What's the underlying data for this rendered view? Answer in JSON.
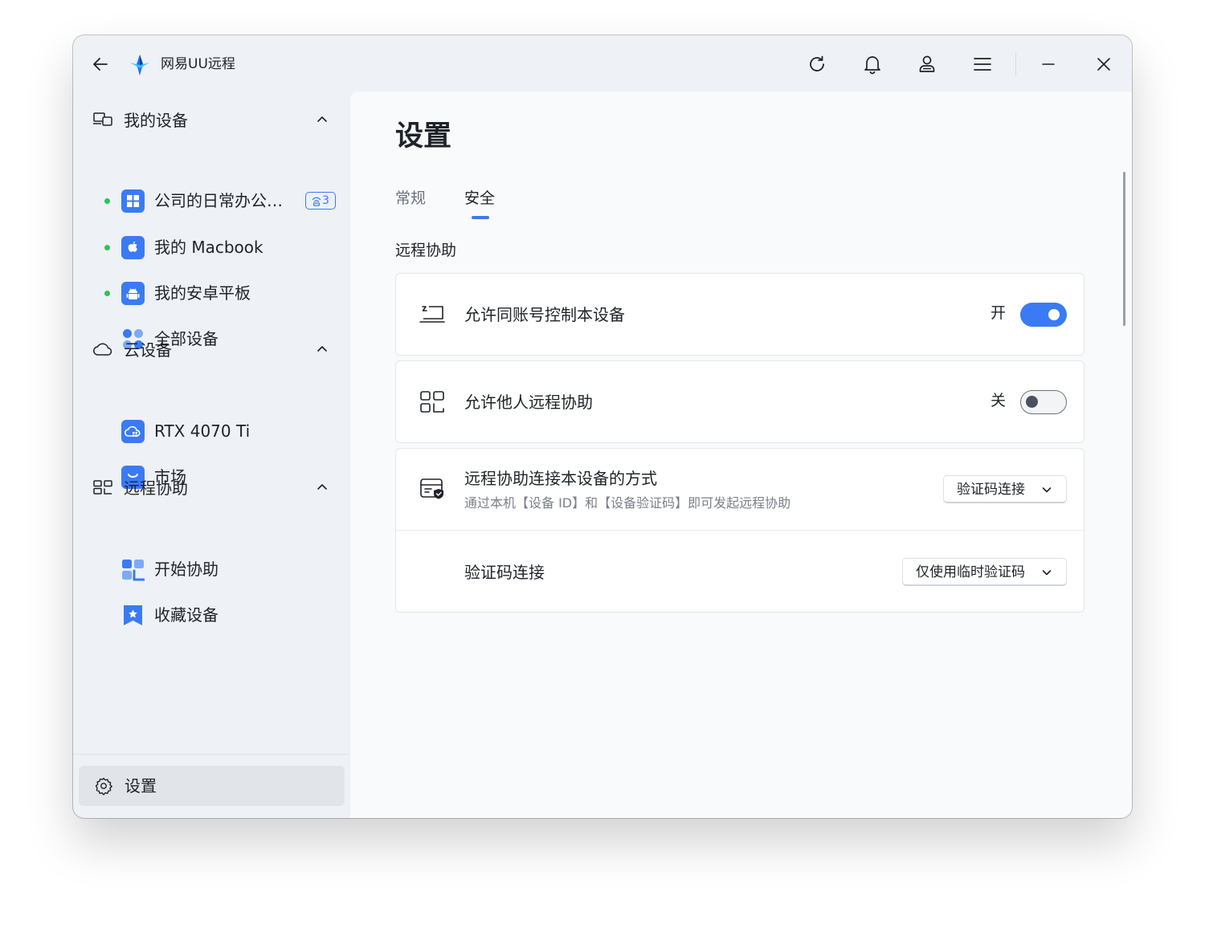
{
  "app": {
    "title": "网易UU远程"
  },
  "sidebar": {
    "groups": [
      {
        "label": "我的设备",
        "items": [
          {
            "label": "公司的日常办公…",
            "online": true,
            "badge": "3"
          },
          {
            "label": "我的 Macbook",
            "online": true
          },
          {
            "label": "我的安卓平板",
            "online": true
          },
          {
            "label": "全部设备",
            "online": false
          }
        ]
      },
      {
        "label": "云设备",
        "items": [
          {
            "label": "RTX 4070 Ti"
          },
          {
            "label": "市场"
          }
        ]
      },
      {
        "label": "远程协助",
        "items": [
          {
            "label": "开始协助"
          },
          {
            "label": "收藏设备"
          }
        ]
      }
    ],
    "settings_label": "设置"
  },
  "main": {
    "title": "设置",
    "tabs": [
      {
        "label": "常规",
        "active": false
      },
      {
        "label": "安全",
        "active": true
      }
    ],
    "section_title": "远程协助",
    "settings": [
      {
        "label": "允许同账号控制本设备",
        "state_label": "开",
        "enabled": true
      },
      {
        "label": "允许他人远程协助",
        "state_label": "关",
        "enabled": false
      }
    ],
    "method_card": {
      "label": "远程协助连接本设备的方式",
      "description": "通过本机【设备 ID】和【设备验证码】即可发起远程协助",
      "select_value": "验证码连接",
      "sub_label": "验证码连接",
      "sub_select_value": "仅使用临时验证码"
    }
  },
  "colors": {
    "accent": "#3a7bf5",
    "online": "#2fc25b"
  }
}
